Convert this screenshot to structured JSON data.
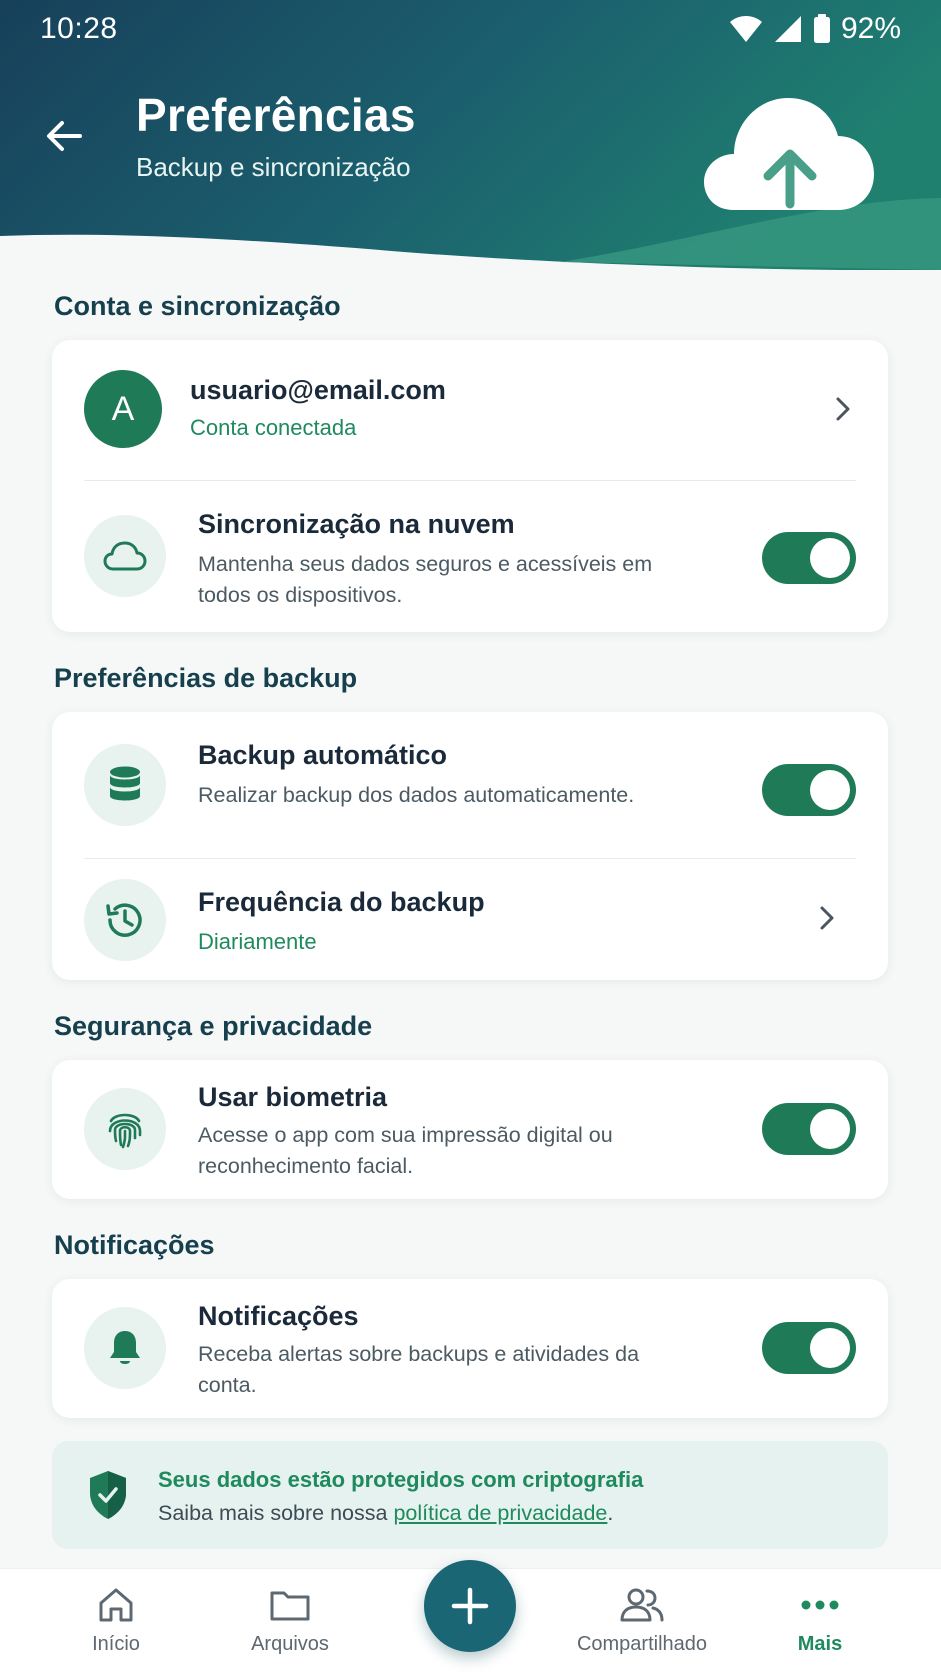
{
  "status_bar": {
    "time": "10:28",
    "battery": "92%"
  },
  "header": {
    "title": "Preferências",
    "subtitle": "Backup e sincronização"
  },
  "sections": {
    "account": {
      "title": "Conta e sincronização",
      "account_row": {
        "avatar_letter": "A",
        "email": "usuario@email.com",
        "status": "Conta conectada"
      },
      "cloud_sync": {
        "title": "Sincronização na nuvem",
        "desc": "Mantenha seus dados seguros e acessíveis em todos os dispositivos.",
        "enabled": true
      }
    },
    "backup": {
      "title": "Preferências de backup",
      "auto_backup": {
        "title": "Backup automático",
        "desc": "Realizar backup dos dados automaticamente.",
        "enabled": true
      },
      "frequency": {
        "title": "Frequência do backup",
        "value": "Diariamente"
      }
    },
    "security": {
      "title": "Segurança e privacidade",
      "biometrics": {
        "title": "Usar biometria",
        "desc": "Acesse o app com sua impressão digital ou reconhecimento facial.",
        "enabled": true
      }
    },
    "notifications": {
      "title": "Notificações",
      "notifications_row": {
        "title": "Notificações",
        "desc": "Receba alertas sobre backups e atividades da conta.",
        "enabled": true
      }
    }
  },
  "info_banner": {
    "title": "Seus dados estão protegidos com criptografia",
    "text_prefix": "Saiba mais sobre nossa ",
    "link": "política de privacidade",
    "text_suffix": "."
  },
  "bottom_nav": {
    "home": "Início",
    "files": "Arquivos",
    "shared": "Compartilhado",
    "more": "Mais"
  },
  "colors": {
    "accent": "#1f7a57",
    "header_dark": "#17475e",
    "header_teal": "#1a7a70",
    "link": "#1f8a5e"
  }
}
